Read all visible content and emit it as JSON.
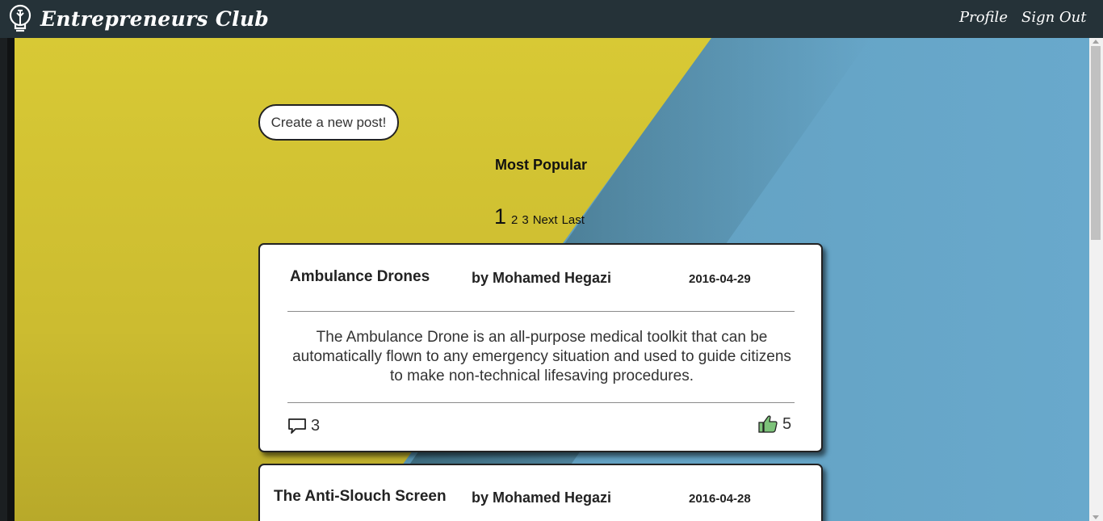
{
  "navbar": {
    "brand": "Entrepreneurs Club",
    "links": [
      "Profile",
      "Sign Out"
    ]
  },
  "main": {
    "create_button": "Create a new post!",
    "section_title": "Most Popular",
    "pagination": {
      "current": "1",
      "pages": [
        "2",
        "3"
      ],
      "next": "Next",
      "last": "Last"
    },
    "posts": [
      {
        "title": "Ambulance Drones",
        "author": "by Mohamed Hegazi",
        "date": "2016-04-29",
        "body": "The Ambulance Drone is an all-purpose medical toolkit that can be automatically flown to any emergency situation and used to guide citizens to make non-technical lifesaving procedures.",
        "comments": "3",
        "likes": "5"
      },
      {
        "title": "The Anti-Slouch Screen",
        "author": "by Mohamed Hegazi",
        "date": "2016-04-28"
      }
    ]
  },
  "colors": {
    "navbar": "#253238",
    "background_yellow": "#d4c334",
    "background_blue": "#66a5c6",
    "like_icon": "#7dc27a"
  }
}
